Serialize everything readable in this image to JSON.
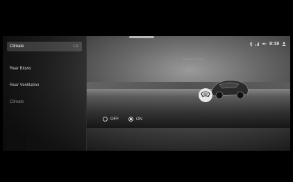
{
  "sidebar": {
    "items": [
      {
        "label": "Climate",
        "value": "1.0",
        "active": true
      },
      {
        "label": "Rear Blows",
        "active": false
      },
      {
        "label": "Rear Ventilation",
        "active": false
      },
      {
        "label": "Climate",
        "active": false
      }
    ]
  },
  "status_bar": {
    "time": "8:19",
    "icons": [
      "bluetooth-icon",
      "signal-icon",
      "mute-icon",
      "user-icon"
    ]
  },
  "scene": {
    "caption": "windshield defrost"
  },
  "defrost": {
    "options": [
      {
        "label": "OFF",
        "selected": false
      },
      {
        "label": "ON",
        "selected": true
      }
    ]
  }
}
